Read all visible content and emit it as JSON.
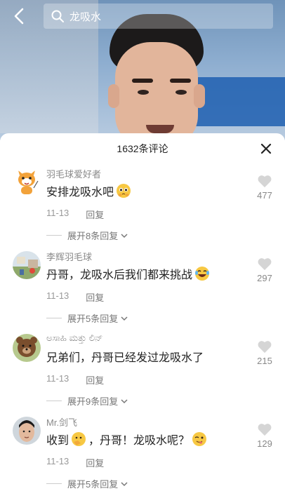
{
  "search": {
    "query": "龙吸水"
  },
  "sheet": {
    "title": "1632条评论"
  },
  "comments": [
    {
      "username": "羽毛球爱好者",
      "text": "安排龙吸水吧",
      "date": "11-13",
      "reply_label": "回复",
      "expand_label": "展开8条回复",
      "likes": "477",
      "emoji": "pleading"
    },
    {
      "username": "李辉羽毛球",
      "text": "丹哥，龙吸水后我们都来挑战",
      "date": "11-13",
      "reply_label": "回复",
      "expand_label": "展开5条回复",
      "likes": "297",
      "emoji": "laugh-cry"
    },
    {
      "username": "ಅಸಾಹಿ ಮತ್ತು ಲಿನ್",
      "text": "兄弟们，丹哥已经发过龙吸水了",
      "date": "11-13",
      "reply_label": "回复",
      "expand_label": "展开9条回复",
      "likes": "215",
      "emoji": ""
    },
    {
      "username": "Mr.剑飞",
      "text_before": "收到",
      "text_after": "，丹哥！龙吸水呢？",
      "date": "11-13",
      "reply_label": "回复",
      "expand_label": "展开5条回复",
      "likes": "129",
      "emoji": "wink"
    }
  ],
  "colors": {
    "accent_gray": "#999999",
    "sheet_bg": "#ffffff"
  }
}
